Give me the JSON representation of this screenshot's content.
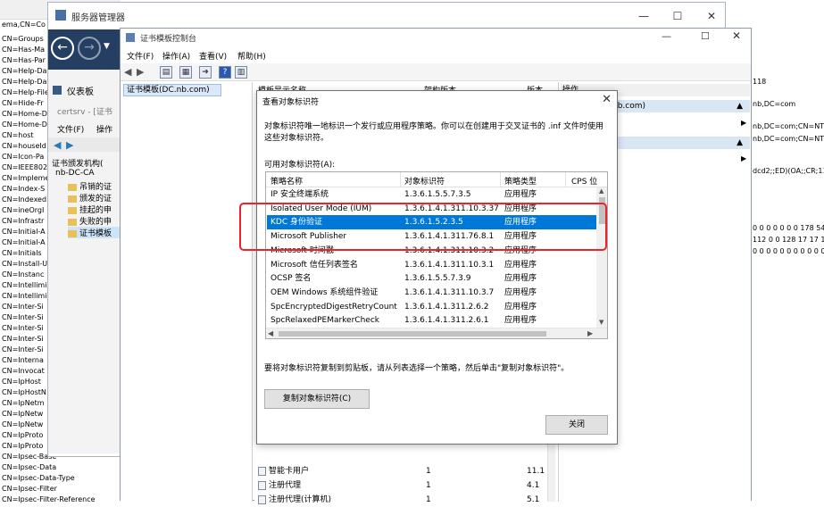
{
  "left_strip": {
    "top_text": "ema,CN=Co",
    "items": [
      "CN=Groups",
      "CN=Has-Ma",
      "CN=Has-Par",
      "CN=Help-Da",
      "CN=Help-Da",
      "CN=Help-File",
      "CN=Hide-Fr",
      "CN=Home-D",
      "CN=Home-D",
      "CN=host",
      "CN=houseId",
      "CN=Icon-Pa",
      "CN=IEEE802",
      "CN=Impleme",
      "CN=Index-S",
      "CN=Indexed",
      "CN=ineOrgI",
      "CN=Infrastr",
      "CN=Initial-A",
      "CN=Initial-A",
      "CN=Initials",
      "CN=Install-U",
      "CN=Instanc",
      "CN=Intellimi",
      "CN=Intellimi",
      "CN=Inter-Si",
      "CN=Inter-Si",
      "CN=Inter-Si",
      "CN=Inter-Si",
      "CN=Inter-Si",
      "CN=Interna",
      "CN=Invocat",
      "CN=IpHost",
      "CN=IpHostN",
      "CN=IpNetm",
      "CN=IpNetw",
      "CN=IpNetw",
      "CN=IpProto",
      "CN=IpProto",
      "CN=Ipsec-Base",
      "CN=Ipsec-Data",
      "CN=Ipsec-Data-Type",
      "CN=Ipsec-Filter",
      "CN=Ipsec-Filter-Reference"
    ]
  },
  "server_manager": {
    "title": "服务器管理器",
    "dashboard": "仪表板",
    "certsrv_title": "certsrv - [证书",
    "menu_file": "文件(F)",
    "menu_action": "操作",
    "tree": [
      "证书颁发机构(",
      "nb-DC-CA",
      "吊销的证",
      "颁发的证",
      "挂起的申",
      "失败的申",
      "证书模板"
    ]
  },
  "cert_console": {
    "title": "证书模板控制台",
    "menus": [
      "文件(F)",
      "操作(A)",
      "查看(V)",
      "帮助(H)"
    ],
    "tree_root": "证书模板(DC.nb.com)",
    "list_header_fragment": "模板显示名称",
    "list_header_fragment2": "架构版本",
    "list_header_fragment3": "版本",
    "bottom_rows": [
      {
        "name": "智能卡用户",
        "schema": "1",
        "version": "11.1"
      },
      {
        "name": "注册代理",
        "schema": "1",
        "version": "4.1"
      },
      {
        "name": "注册代理(计算机)",
        "schema": "1",
        "version": "5.1"
      }
    ],
    "actions_header": "操作",
    "actions_band1": "nb.com)",
    "actions_band1_arrow": "▲",
    "actions_band2_arrow": "▲",
    "actions_more_arrow": "▶"
  },
  "right_edge": {
    "line1": "118",
    "line2": "nb,DC=com",
    "line3": "nb,DC=com;CN=NTD",
    "line4": "nb,DC=com;CN=NTD",
    "line5": "dcd2;;ED)(OA;;CR;113",
    "line6": "0 0 0 0 0 0 0 178 54 28",
    "line7": "112 0 0 128 17 17 17 1",
    "line8": "0 0 0 0 0 0 0 0 0 0 0 0 0 0 0"
  },
  "dialog": {
    "title": "查看对象标识符",
    "description": "对象标识符唯一地标识一个发行或应用程序策略。你可以在创建用于交叉证书的 .inf 文件时使用这些对象标识符。",
    "available_label": "可用对象标识符(A):",
    "columns": [
      "策略名称",
      "对象标识符",
      "策略类型",
      "CPS 位"
    ],
    "rows": [
      {
        "name": "IP 安全终端系统",
        "oid": "1.3.6.1.5.5.7.3.5",
        "type": "应用程序",
        "selected": false
      },
      {
        "name": "Isolated User Mode (IUM)",
        "oid": "1.3.6.1.4.1.311.10.3.37",
        "type": "应用程序",
        "selected": false
      },
      {
        "name": "KDC 身份验证",
        "oid": "1.3.6.1.5.2.3.5",
        "type": "应用程序",
        "selected": true
      },
      {
        "name": "Microsoft Publisher",
        "oid": "1.3.6.1.4.1.311.76.8.1",
        "type": "应用程序",
        "selected": false
      },
      {
        "name": "Microsoft 时间戳",
        "oid": "1.3.6.1.4.1.311.10.3.2",
        "type": "应用程序",
        "selected": false
      },
      {
        "name": "Microsoft 信任列表签名",
        "oid": "1.3.6.1.4.1.311.10.3.1",
        "type": "应用程序",
        "selected": false
      },
      {
        "name": "OCSP 签名",
        "oid": "1.3.6.1.5.5.7.3.9",
        "type": "应用程序",
        "selected": false
      },
      {
        "name": "OEM Windows 系统组件验证",
        "oid": "1.3.6.1.4.1.311.10.3.7",
        "type": "应用程序",
        "selected": false
      },
      {
        "name": "SpcEncryptedDigestRetryCount",
        "oid": "1.3.6.1.4.1.311.2.6.2",
        "type": "应用程序",
        "selected": false
      },
      {
        "name": "SpcRelaxedPEMarkerCheck",
        "oid": "1.3.6.1.4.1.311.2.6.1",
        "type": "应用程序",
        "selected": false
      }
    ],
    "hint": "要将对象标识符复制到剪贴板，请从列表选择一个策略，然后单击\"复制对象标识符\"。",
    "copy_button": "复制对象标识符(C)",
    "close_button": "关闭"
  },
  "colors": {
    "selection": "#0078d7",
    "annotation_box": "#e8252a",
    "sm_nav": "#253f63"
  }
}
